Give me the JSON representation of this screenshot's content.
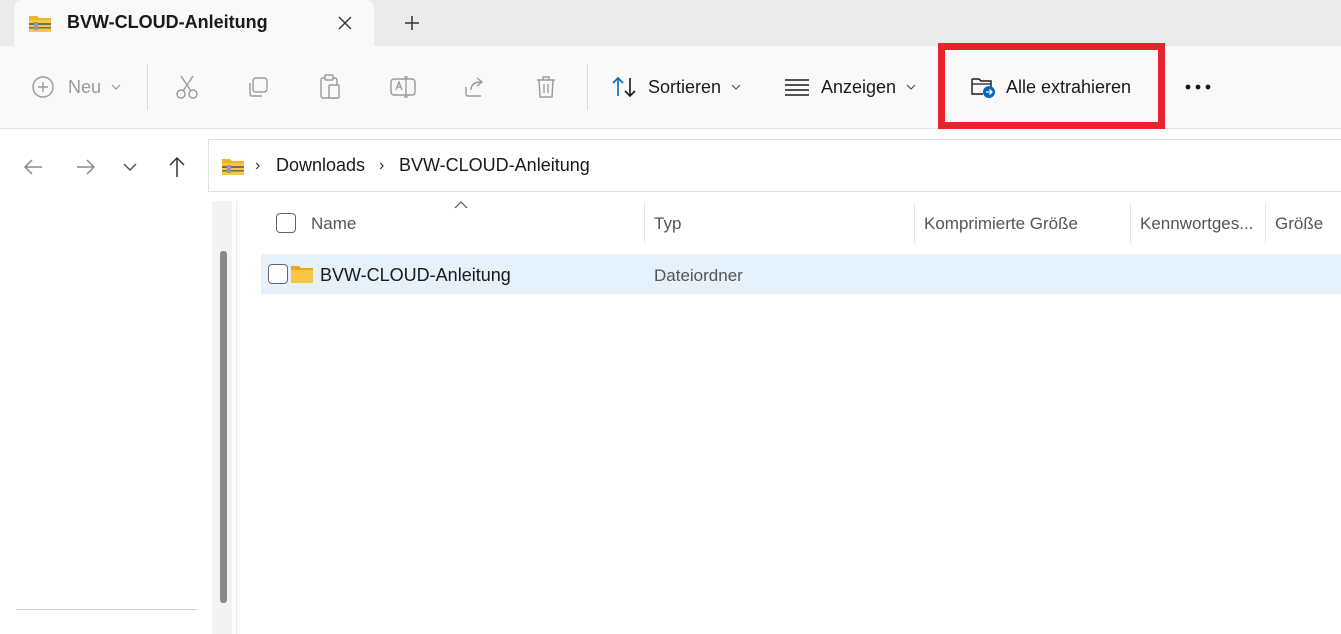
{
  "tab": {
    "title": "BVW-CLOUD-Anleitung",
    "close_icon": "close-icon",
    "new_tab_icon": "plus-icon"
  },
  "toolbar": {
    "new_label": "Neu",
    "sort_label": "Sortieren",
    "view_label": "Anzeigen",
    "extract_all_label": "Alle extrahieren",
    "more_icon": "more-icon"
  },
  "breadcrumb": {
    "items": [
      "Downloads",
      "BVW-CLOUD-Anleitung"
    ]
  },
  "columns": {
    "name": "Name",
    "type": "Typ",
    "compressed_size": "Komprimierte Größe",
    "password": "Kennwortges...",
    "size": "Größe"
  },
  "files": [
    {
      "name": "BVW-CLOUD-Anleitung",
      "type": "Dateiordner"
    }
  ],
  "colors": {
    "highlight": "#e8232e",
    "selection": "#e5f1fb",
    "accent": "#0067c0",
    "folder": "#f8c643"
  }
}
